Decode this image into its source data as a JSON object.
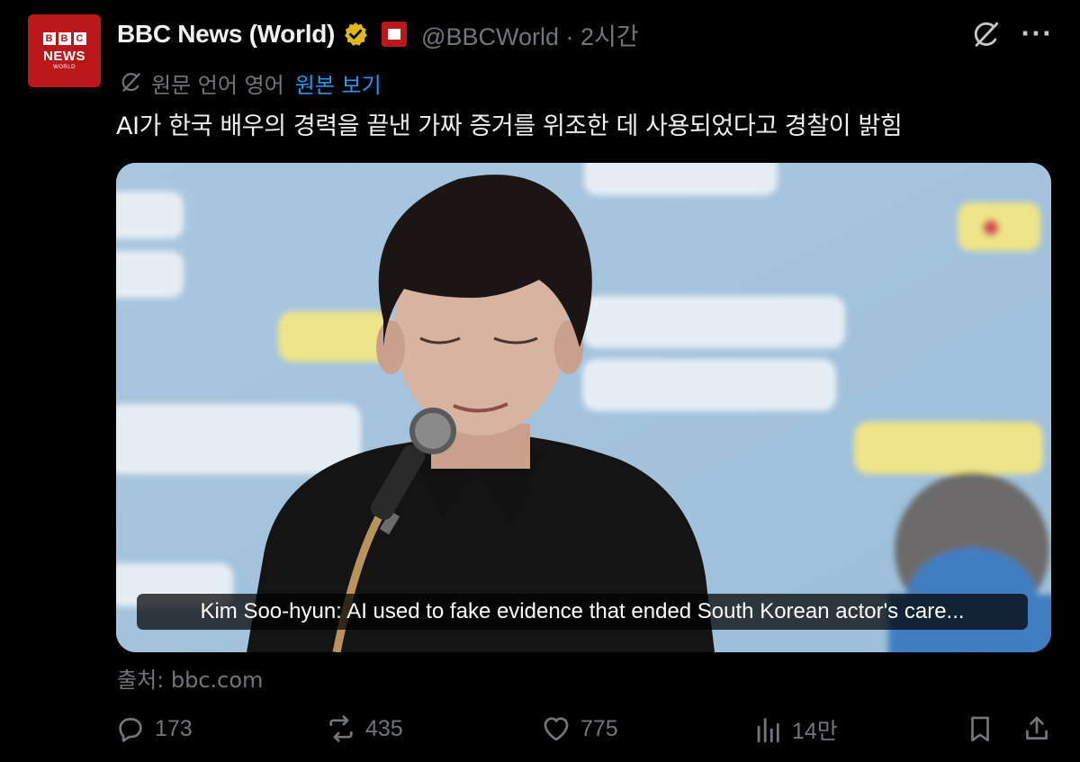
{
  "post": {
    "author_name": "BBC News (World)",
    "handle_time": "@BBCWorld · 2시간",
    "translation_label": "원문 언어 영어",
    "translation_link": "원본 보기",
    "text": "AI가 한국 배우의 경력을 끝낸 가짜 증거를 위조한 데 사용되었다고 경찰이 밝힘",
    "avatar": {
      "logo_letters": [
        "B",
        "B",
        "C"
      ],
      "line1": "NEWS",
      "line2": "WORLD"
    },
    "card": {
      "headline": "Kim Soo-hyun: AI used to fake evidence that ended South Korean actor's care...",
      "source": "출처: bbc.com"
    }
  },
  "actions": {
    "replies": "173",
    "reposts": "435",
    "likes": "775",
    "views": "14만"
  },
  "icons": {
    "verified": "verified-badge-icon",
    "affiliate": "bbc-affiliate-icon",
    "grok": "grok-icon",
    "more": "more-icon",
    "reply": "reply-icon",
    "repost": "repost-icon",
    "like": "heart-icon",
    "views": "views-icon",
    "bookmark": "bookmark-icon",
    "share": "share-icon"
  },
  "colors": {
    "background": "#000000",
    "link": "#1d9bf0",
    "muted": "#71767b",
    "bbc_red": "#bb1919",
    "verified_gold": "#e2b719"
  }
}
